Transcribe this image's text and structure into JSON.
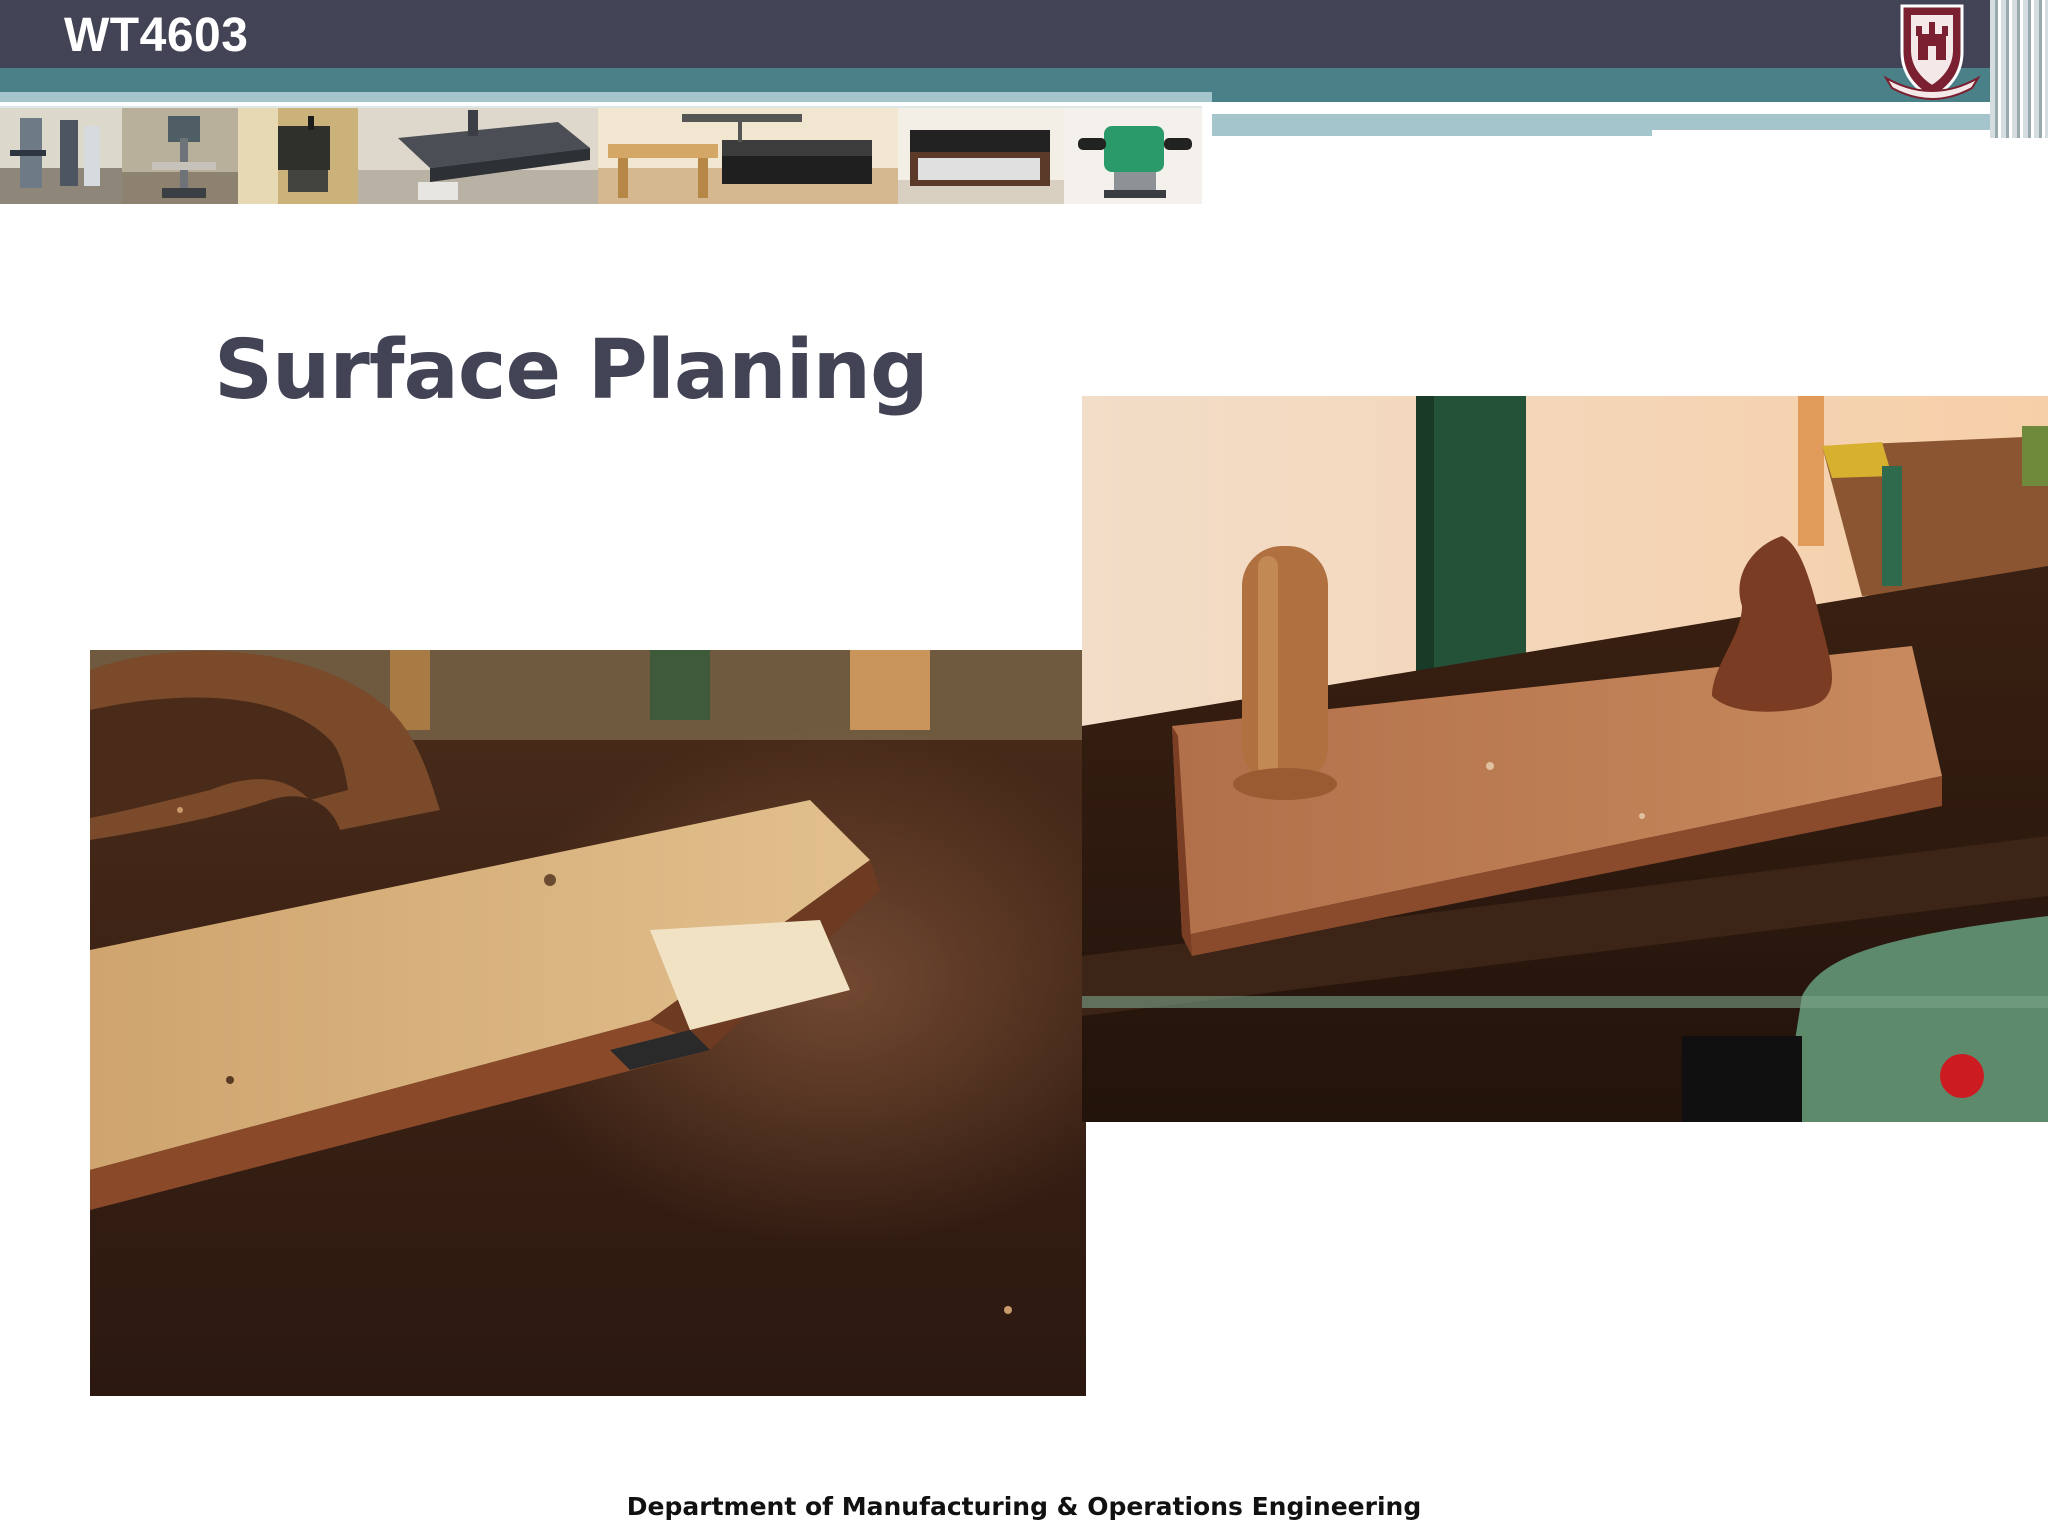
{
  "header": {
    "course_code": "WT4603"
  },
  "slide": {
    "title": "Surface Planing"
  },
  "images": {
    "logo": "university-crest-icon",
    "machine_strip": [
      "bandsaw-photo",
      "pillar-drill-photo",
      "scroll-saw-photo",
      "planer-thicknesser-photo",
      "table-saw-photo",
      "router-table-photo",
      "hand-router-photo"
    ],
    "photo_left": "hand-plane-closeup-photo",
    "photo_right": "wooden-plane-on-bench-photo"
  },
  "footer": {
    "text": "Department of Manufacturing & Operations Engineering"
  },
  "colors": {
    "header_dark": "#434356",
    "teal": "#4a8088",
    "light_teal": "#a5c5cc",
    "title": "#434356"
  }
}
